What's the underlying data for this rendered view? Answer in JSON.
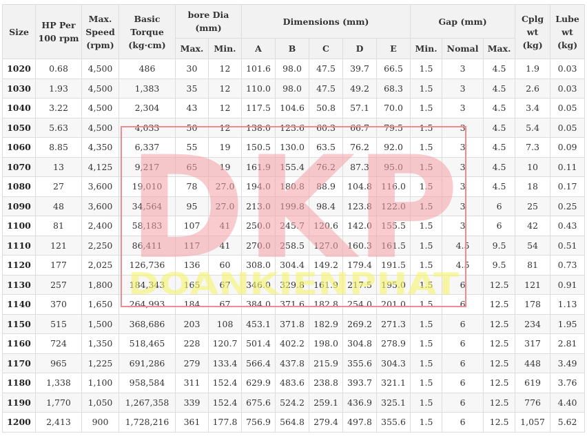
{
  "header": {
    "size": "Size",
    "hp": "HP Per 100 rpm",
    "speed": "Max. Speed (rpm)",
    "torque": "Basic Torque (kg·cm)",
    "bore": "bore Dia (mm)",
    "bore_max": "Max.",
    "bore_min": "Min.",
    "dims": "Dimensions (mm)",
    "dim_a": "A",
    "dim_b": "B",
    "dim_c": "C",
    "dim_d": "D",
    "dim_e": "E",
    "gap": "Gap (mm)",
    "gap_min": "Min.",
    "gap_nomal": "Nomal",
    "gap_max": "Max.",
    "cplg": "Cplg wt (kg)",
    "lube": "Lube wt (kg)"
  },
  "rows": [
    [
      "1020",
      "0.68",
      "4,500",
      "486",
      "30",
      "12",
      "101.6",
      "98.0",
      "47.5",
      "39.7",
      "66.5",
      "1.5",
      "3",
      "4.5",
      "1.9",
      "0.03"
    ],
    [
      "1030",
      "1.93",
      "4,500",
      "1,383",
      "35",
      "12",
      "110.0",
      "98.0",
      "47.5",
      "49.2",
      "68.3",
      "1.5",
      "3",
      "4.5",
      "2.6",
      "0.03"
    ],
    [
      "1040",
      "3.22",
      "4,500",
      "2,304",
      "43",
      "12",
      "117.5",
      "104.6",
      "50.8",
      "57.1",
      "70.0",
      "1.5",
      "3",
      "4.5",
      "3.4",
      "0.05"
    ],
    [
      "1050",
      "5.63",
      "4,500",
      "4,033",
      "50",
      "12",
      "138.0",
      "123.6",
      "60.3",
      "66.7",
      "79.5",
      "1.5",
      "3",
      "4.5",
      "5.4",
      "0.05"
    ],
    [
      "1060",
      "8.85",
      "4,350",
      "6,337",
      "55",
      "19",
      "150.5",
      "130.0",
      "63.5",
      "76.2",
      "92.0",
      "1.5",
      "3",
      "4.5",
      "7.3",
      "0.09"
    ],
    [
      "1070",
      "13",
      "4,125",
      "9,217",
      "65",
      "19",
      "161.9",
      "155.4",
      "76.2",
      "87.3",
      "95.0",
      "1.5",
      "3",
      "4.5",
      "10",
      "0.11"
    ],
    [
      "1080",
      "27",
      "3,600",
      "19,010",
      "78",
      "27.0",
      "194.0",
      "180.8",
      "88.9",
      "104.8",
      "116.0",
      "1.5",
      "3",
      "4.5",
      "18",
      "0.17"
    ],
    [
      "1090",
      "48",
      "3,600",
      "34,564",
      "95",
      "27.0",
      "213.0",
      "199.8",
      "98.4",
      "123.8",
      "122.0",
      "1.5",
      "3",
      "6",
      "25",
      "0.25"
    ],
    [
      "1100",
      "81",
      "2,400",
      "58,183",
      "107",
      "41",
      "250.0",
      "245.7",
      "120.6",
      "142.0",
      "155.5",
      "1.5",
      "3",
      "6",
      "42",
      "0.43"
    ],
    [
      "1110",
      "121",
      "2,250",
      "86,411",
      "117",
      "41",
      "270.0",
      "258.5",
      "127.0",
      "160.3",
      "161.5",
      "1.5",
      "4.5",
      "9.5",
      "54",
      "0.51"
    ],
    [
      "1120",
      "177",
      "2,025",
      "126,736",
      "136",
      "60",
      "308.0",
      "304.4",
      "149.2",
      "179.4",
      "191.5",
      "1.5",
      "4.5",
      "9.5",
      "81",
      "0.73"
    ],
    [
      "1130",
      "257",
      "1,800",
      "184,343",
      "165",
      "67",
      "346.0",
      "329.8",
      "161.9",
      "217.5",
      "195.0",
      "1.5",
      "6",
      "12.5",
      "121",
      "0.91"
    ],
    [
      "1140",
      "370",
      "1,650",
      "264,993",
      "184",
      "67",
      "384.0",
      "371.6",
      "182.8",
      "254.0",
      "201.0",
      "1.5",
      "6",
      "12.5",
      "178",
      "1.13"
    ],
    [
      "1150",
      "515",
      "1,500",
      "368,686",
      "203",
      "108",
      "453.1",
      "371.8",
      "182.9",
      "269.2",
      "271.3",
      "1.5",
      "6",
      "12.5",
      "234",
      "1.95"
    ],
    [
      "1160",
      "724",
      "1,350",
      "518,465",
      "228",
      "120.7",
      "501.4",
      "402.2",
      "198.0",
      "304.8",
      "278.9",
      "1.5",
      "6",
      "12.5",
      "317",
      "2.81"
    ],
    [
      "1170",
      "965",
      "1,225",
      "691,286",
      "279",
      "133.4",
      "566.4",
      "437.8",
      "215.9",
      "355.6",
      "304.3",
      "1.5",
      "6",
      "12.5",
      "448",
      "3.49"
    ],
    [
      "1180",
      "1,338",
      "1,100",
      "958,584",
      "311",
      "152.4",
      "629.9",
      "483.6",
      "238.8",
      "393.7",
      "321.1",
      "1.5",
      "6",
      "12.5",
      "619",
      "3.76"
    ],
    [
      "1190",
      "1,770",
      "1,050",
      "1,267,358",
      "339",
      "152.4",
      "675.6",
      "524.2",
      "259.1",
      "436.9",
      "325.1",
      "1.5",
      "6",
      "12.5",
      "776",
      "4.40"
    ],
    [
      "1200",
      "2,413",
      "900",
      "1,728,216",
      "361",
      "177.8",
      "756.9",
      "564.8",
      "279.4",
      "497.8",
      "355.6",
      "1.5",
      "6",
      "12.5",
      "1,057",
      "5.62"
    ]
  ],
  "watermark": {
    "logo": "DKP",
    "text": "DOANKIENPHAT",
    "logo_color": "#f4a0a6",
    "text_color": "#f3f36a",
    "frame_color": "#f08a92"
  }
}
